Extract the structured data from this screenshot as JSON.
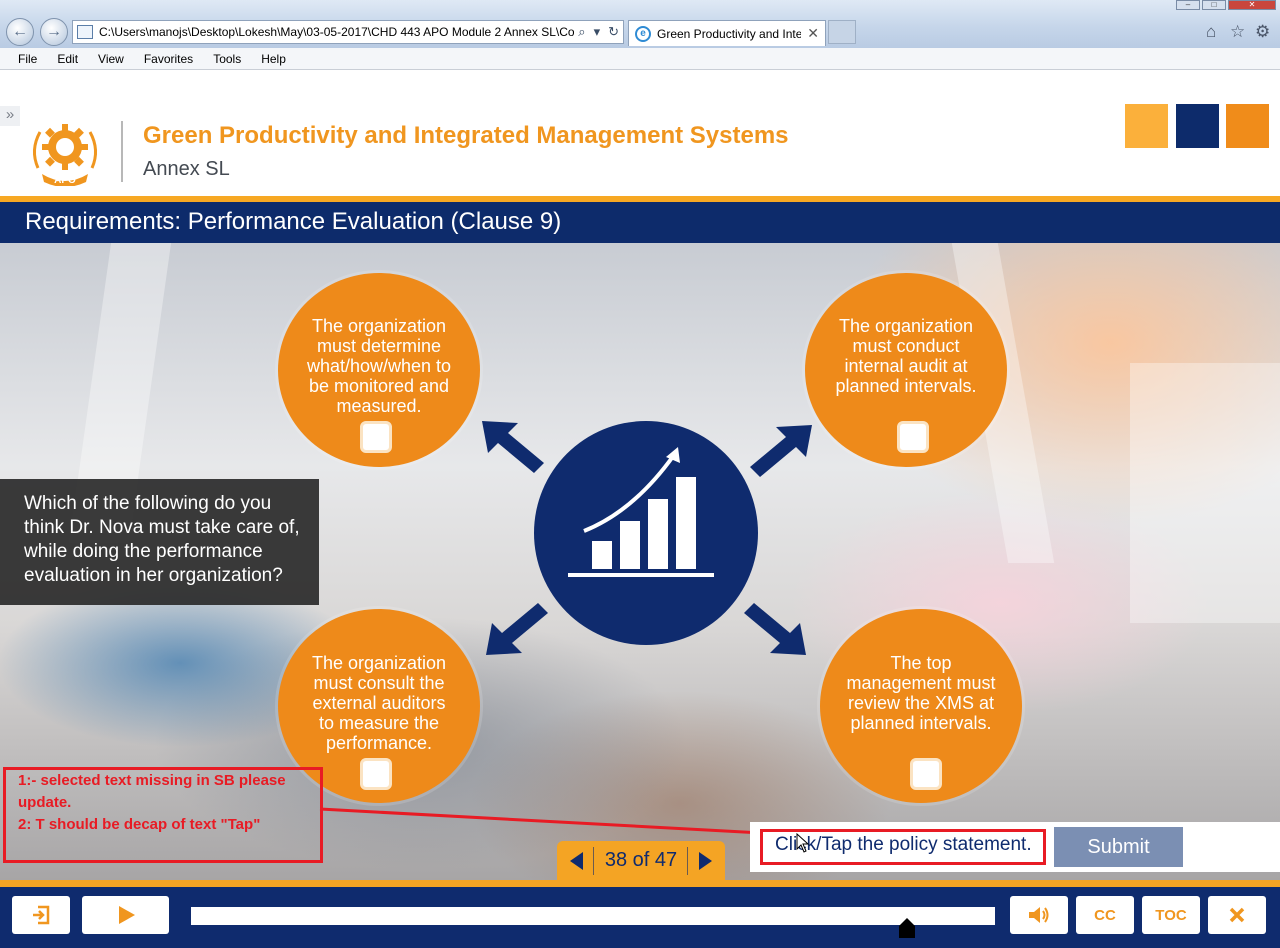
{
  "browser": {
    "address": "C:\\Users\\manojs\\Desktop\\Lokesh\\May\\03-05-2017\\CHD 443 APO Module 2 Annex SL\\Co",
    "tab_title": "Green Productivity and Inte...",
    "menu": [
      "File",
      "Edit",
      "View",
      "Favorites",
      "Tools",
      "Help"
    ]
  },
  "course": {
    "logo_text": "APO",
    "title": "Green Productivity and Integrated Management Systems",
    "subtitle": "Annex SL",
    "swatch_colors": [
      "#fbb03b",
      "#0d2b6b",
      "#f08c1a"
    ]
  },
  "slide": {
    "title": "Requirements: Performance Evaluation (Clause 9)",
    "question": "Which of the following do you think Dr. Nova must take care of, while doing the performance evaluation in her organization?",
    "options": [
      "The organization must determine what/how/when to be monitored and measured.",
      "The organization must conduct internal audit at planned intervals.",
      "The organization must consult the external auditors to measure the performance.",
      "The top management must review the XMS at planned intervals."
    ],
    "center_icon": "growth-chart-icon",
    "instruction": "Click/Tap the policy statement.",
    "submit_label": "Submit",
    "annotation_lines": [
      "1:- selected text missing in SB please update.",
      "2: T should be decap of text \"Tap\""
    ]
  },
  "pager": {
    "label": "38 of 47"
  },
  "player": {
    "buttons": {
      "exit": "exit-icon",
      "play": "play-icon",
      "volume": "speaker-icon",
      "cc": "CC",
      "toc": "TOC",
      "close": "close-icon"
    },
    "progress": 0.89
  },
  "colors": {
    "orange": "#ee8a1a",
    "navy": "#0f2b6e",
    "annotation_red": "#e81b24"
  }
}
